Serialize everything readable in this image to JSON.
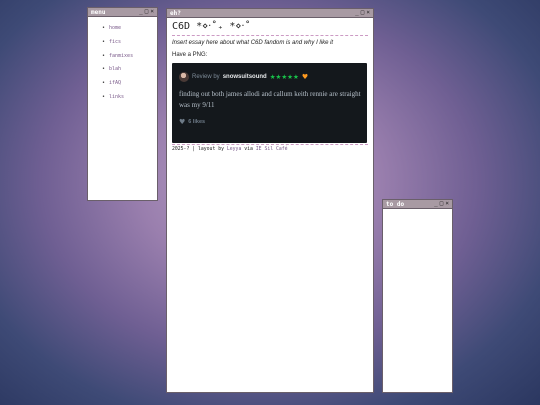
{
  "menu_window": {
    "title": "menu",
    "controls": [
      "_",
      "□",
      "×"
    ],
    "items": [
      "home",
      "fics",
      "fanmixes",
      "blah",
      "ifAQ",
      "links"
    ]
  },
  "main_window": {
    "title": "eh?",
    "controls": [
      "_",
      "□",
      "×"
    ],
    "heading": "C6D *⋄‧˚₊ *⋄‧˚",
    "intro": "Insert essay here about what C6D fandom is and why I like it",
    "have_png": "Have a PNG:",
    "review_card": {
      "review_by": "Review by",
      "username": "snowsuitsound",
      "stars": "★★★★★",
      "review_text": "finding out both james allodi and callum keith rennie are straight was my 9/11",
      "likes": "6 likes",
      "colors": {
        "stars": "#18c34a",
        "heart": "#ff9a1f",
        "background": "#14181c"
      }
    },
    "footer": {
      "year": "2025-?",
      "sep": "|",
      "layout_by": "layout by",
      "author": "Leyya",
      "via": "via",
      "source": "IE Sil Café"
    }
  },
  "todo_window": {
    "title": "to do",
    "controls": [
      "_",
      "□",
      "×"
    ]
  }
}
